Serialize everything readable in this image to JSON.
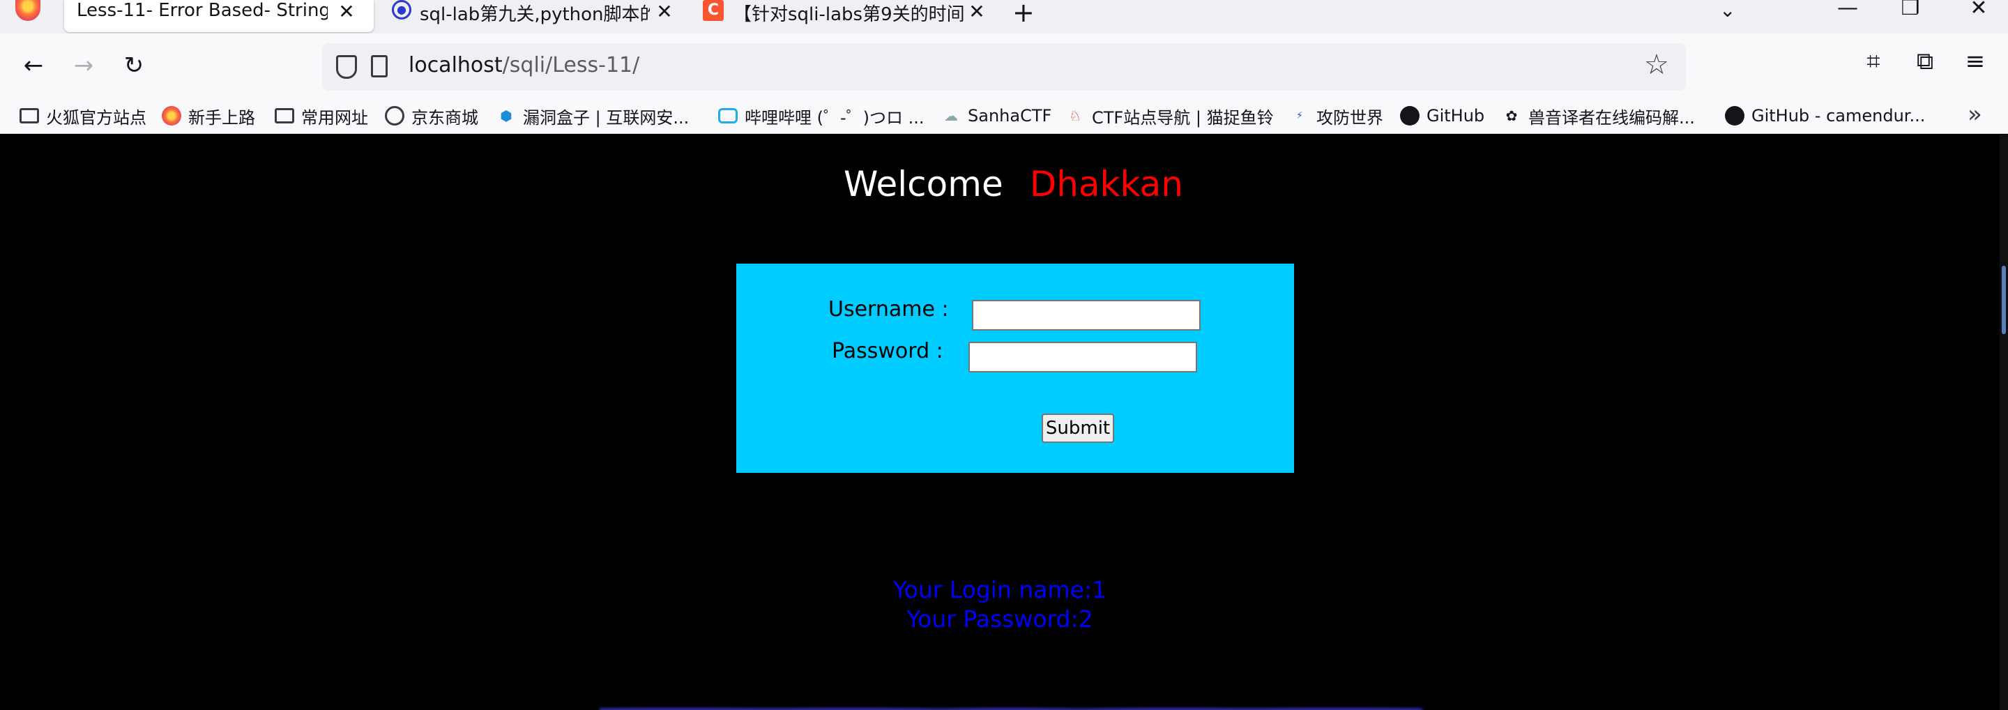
{
  "tabs": [
    {
      "title": "Less-11- Error Based- String",
      "active": true
    },
    {
      "title": "sql-lab第九关,python脚本的编写",
      "active": false
    },
    {
      "title": "【针对sqli-labs第9关的时间盲注",
      "active": false
    }
  ],
  "url": {
    "host": "localhost",
    "path": "/sqli/Less-11/"
  },
  "bookmarks": [
    {
      "label": "火狐官方站点",
      "icon": "folder-icon"
    },
    {
      "label": "新手上路",
      "icon": "firefox-icon"
    },
    {
      "label": "常用网址",
      "icon": "folder-icon"
    },
    {
      "label": "京东商城",
      "icon": "globe-icon"
    },
    {
      "label": "漏洞盒子 | 互联网安...",
      "icon": "hexagon-icon"
    },
    {
      "label": "哔哩哔哩 (゜-゜)つロ ...",
      "icon": "bilibili-icon"
    },
    {
      "label": "SanhaCTF",
      "icon": "sanha-icon"
    },
    {
      "label": "CTF站点导航 | 猫捉鱼铃",
      "icon": "cat-icon"
    },
    {
      "label": "攻防世界",
      "icon": "adworld-icon"
    },
    {
      "label": "GitHub",
      "icon": "github-icon"
    },
    {
      "label": "兽音译者在线编码解...",
      "icon": "paw-icon"
    },
    {
      "label": "GitHub - camendur...",
      "icon": "github-icon"
    }
  ],
  "page": {
    "welcome": "Welcome",
    "user": "Dhakkan",
    "username_label": "Username :",
    "password_label": "Password :",
    "submit": "Submit",
    "login_name": "Your Login name:1",
    "login_password": "Your Password:2"
  },
  "colors": {
    "accent_box": "#00ccff",
    "welcome_name": "#ff0000",
    "result_text": "#0000ff",
    "background": "#000000"
  }
}
